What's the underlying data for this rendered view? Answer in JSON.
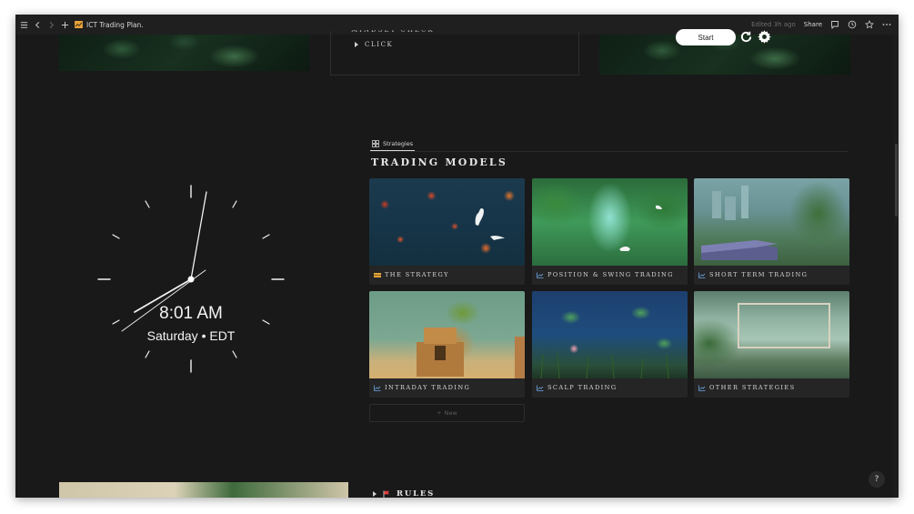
{
  "topbar": {
    "title": "ICT Trading Plan.",
    "edited": "Edited 3h ago",
    "share_label": "Share"
  },
  "mindset": {
    "partial_heading": "MINDSET CHECK",
    "click_label": "CLICK"
  },
  "timer": {
    "start_label": "Start"
  },
  "clock": {
    "time": "8:01 AM",
    "date": "Saturday • EDT"
  },
  "database": {
    "tab_label": "Strategies",
    "title": "TRADING MODELS",
    "cards": [
      {
        "label": "THE STRATEGY",
        "icon": "strategy-icon"
      },
      {
        "label": "POSITION & SWING TRADING",
        "icon": "chart-icon"
      },
      {
        "label": "SHORT TERM TRADING",
        "icon": "chart-icon"
      },
      {
        "label": "INTRADAY TRADING",
        "icon": "chart-icon"
      },
      {
        "label": "SCALP TRADING",
        "icon": "chart-icon"
      },
      {
        "label": "OTHER STRATEGIES",
        "icon": "chart-icon"
      }
    ],
    "new_label": "New"
  },
  "rules": {
    "label": "RULES"
  },
  "help": {
    "label": "?"
  },
  "colors": {
    "background": "#191919",
    "card": "#252525",
    "text": "#d6d6d6",
    "accent_blue": "#4a90e2",
    "flag_red": "#e03e3e"
  }
}
